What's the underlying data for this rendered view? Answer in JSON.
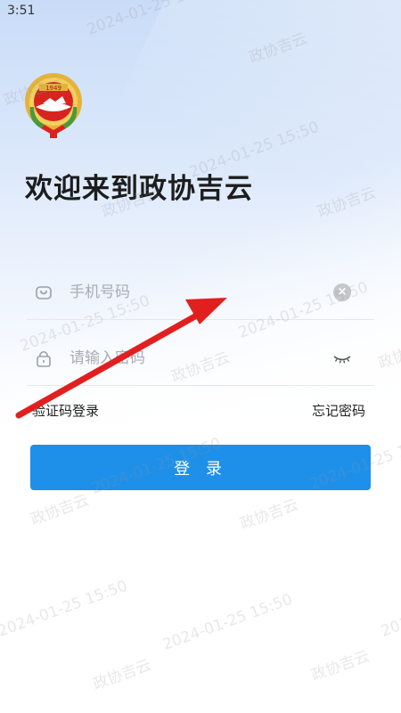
{
  "status_bar": {
    "time": "3:51"
  },
  "header": {
    "emblem_icon": "cppcc-emblem-icon",
    "emblem_text": "1949",
    "welcome_title": "欢迎来到政协吉云"
  },
  "login_form": {
    "phone": {
      "placeholder": "手机号码",
      "value": "",
      "icon": "phone-icon",
      "clear_icon": "clear-icon"
    },
    "password": {
      "placeholder": "请输入密码",
      "value": "",
      "icon": "lock-icon",
      "visibility_icon": "eye-closed-icon"
    },
    "sms_login_link": "验证码登录",
    "forgot_password_link": "忘记密码",
    "login_button": "登 录"
  },
  "watermark": {
    "date_text": "2024-01-25 15:50",
    "name_text": "政协吉云"
  },
  "annotation": {
    "type": "red-arrow",
    "color": "#e21f1f"
  },
  "colors": {
    "primary": "#1e90e9",
    "emblem_red": "#d8231f",
    "emblem_gold": "#e5b33a"
  }
}
